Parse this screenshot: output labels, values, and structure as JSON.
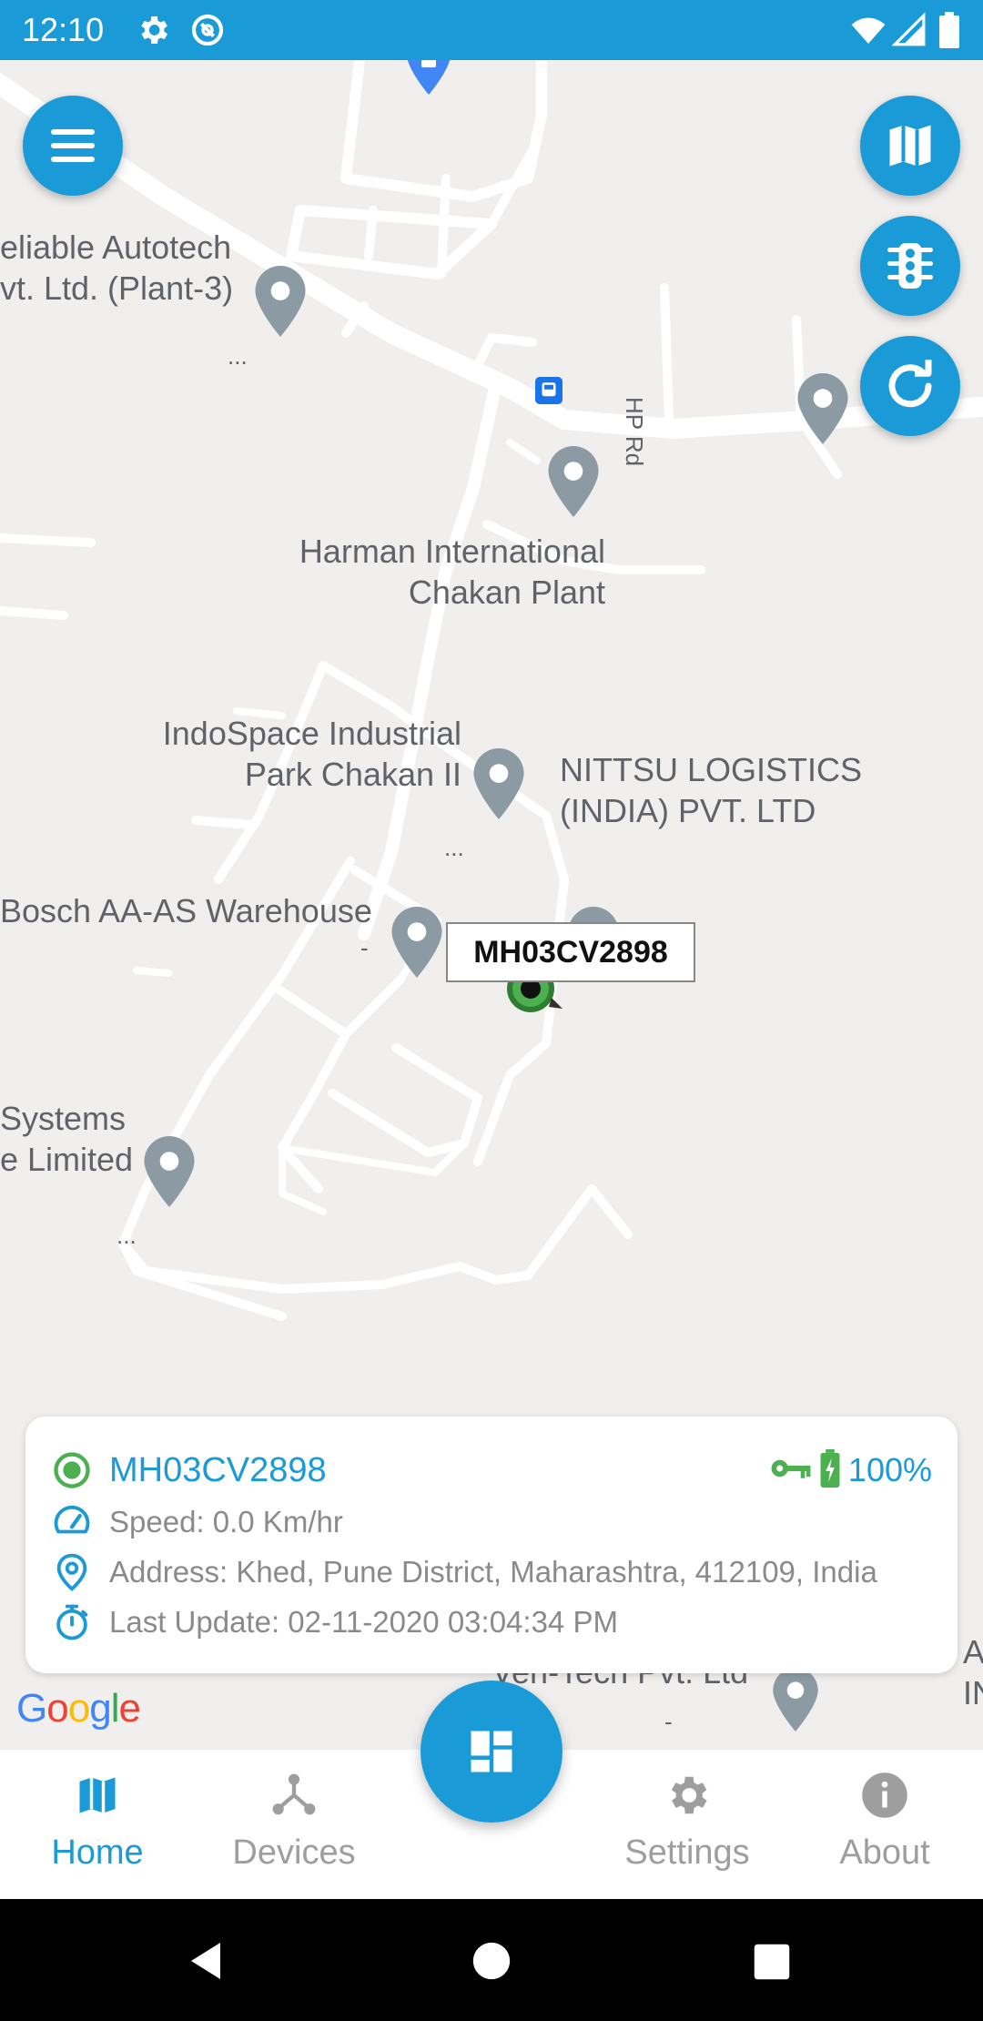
{
  "status_bar": {
    "time": "12:10",
    "icons": [
      "settings-gear-icon",
      "data-saver-icon",
      "wifi-icon",
      "signal-icon",
      "battery-icon"
    ]
  },
  "map": {
    "labels": {
      "reliable": "eliable Autotech\nvt. Ltd. (Plant-3)",
      "harman": "Harman International\nChakan Plant",
      "indospace": "IndoSpace Industrial\nPark Chakan II",
      "nittsu": "NITTSU LOGISTICS\n(INDIA) PVT. LTD",
      "bosch": "Bosch AA-AS Warehouse",
      "systems": "Systems\ne Limited",
      "hp_rd": "HP Rd",
      "ventech": "Ven-Tech Pvt. Ltd",
      "right_edge_a": "A",
      "right_edge_card": "A\nIN"
    },
    "ellipses": [
      "...",
      "...",
      "...",
      "-",
      "-",
      "."
    ],
    "vehicle_marker_label": "MH03CV2898",
    "attribution": "Google"
  },
  "map_controls": {
    "menu": "menu-icon",
    "map_type": "map-icon",
    "traffic": "traffic-light-icon",
    "refresh": "refresh-icon"
  },
  "vehicle_card": {
    "plate": "MH03CV2898",
    "battery_pct": "100%",
    "speed": "Speed: 0.0 Km/hr",
    "address": "Address: Khed, Pune District, Maharashtra, 412109, India",
    "last_update": "Last Update: 02-11-2020 03:04:34 PM"
  },
  "bottom_nav": {
    "items": [
      {
        "label": "Home",
        "icon": "map-icon",
        "active": true
      },
      {
        "label": "Devices",
        "icon": "devices-icon",
        "active": false
      },
      {
        "label": "Settings",
        "icon": "gear-icon",
        "active": false
      },
      {
        "label": "About",
        "icon": "info-icon",
        "active": false
      }
    ],
    "center_fab_icon": "dashboard-icon"
  },
  "colors": {
    "accent": "#1a9bd7",
    "online_green": "#4caf50",
    "map_bg": "#f1efed",
    "pin_gray": "#8c9aa4"
  }
}
